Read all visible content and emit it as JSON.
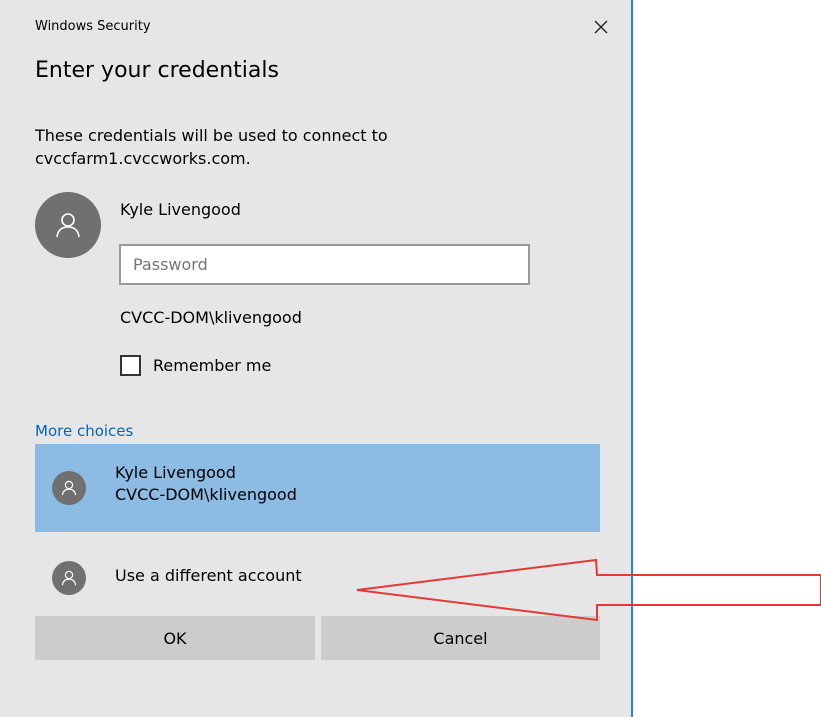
{
  "window": {
    "title": "Windows Security",
    "close_glyph": "✕"
  },
  "dialog": {
    "heading": "Enter your credentials",
    "description": "These credentials will be used to connect to cvccfarm1.cvccworks.com."
  },
  "user": {
    "name": "Kyle Livengood",
    "password_placeholder": "Password",
    "password_value": "",
    "domain_account": "CVCC-DOM\\klivengood"
  },
  "remember": {
    "label": "Remember me",
    "checked": false
  },
  "more_choices": {
    "link": "More choices",
    "accounts": [
      {
        "name": "Kyle Livengood",
        "detail": "CVCC-DOM\\klivengood",
        "selected": true
      },
      {
        "name": "Use a different account",
        "selected": false
      }
    ]
  },
  "buttons": {
    "ok": "OK",
    "cancel": "Cancel"
  },
  "colors": {
    "dialog_bg": "#e6e6e6",
    "selected_bg": "#8cbbe4",
    "link": "#0067b8",
    "button_bg": "#cccccc",
    "avatar": "#707070",
    "annotation_arrow": "#e53935",
    "window_border": "#1e88e5"
  },
  "icons": {
    "avatar": "person-icon",
    "close": "close-icon",
    "annotation": "arrow-annotation"
  }
}
